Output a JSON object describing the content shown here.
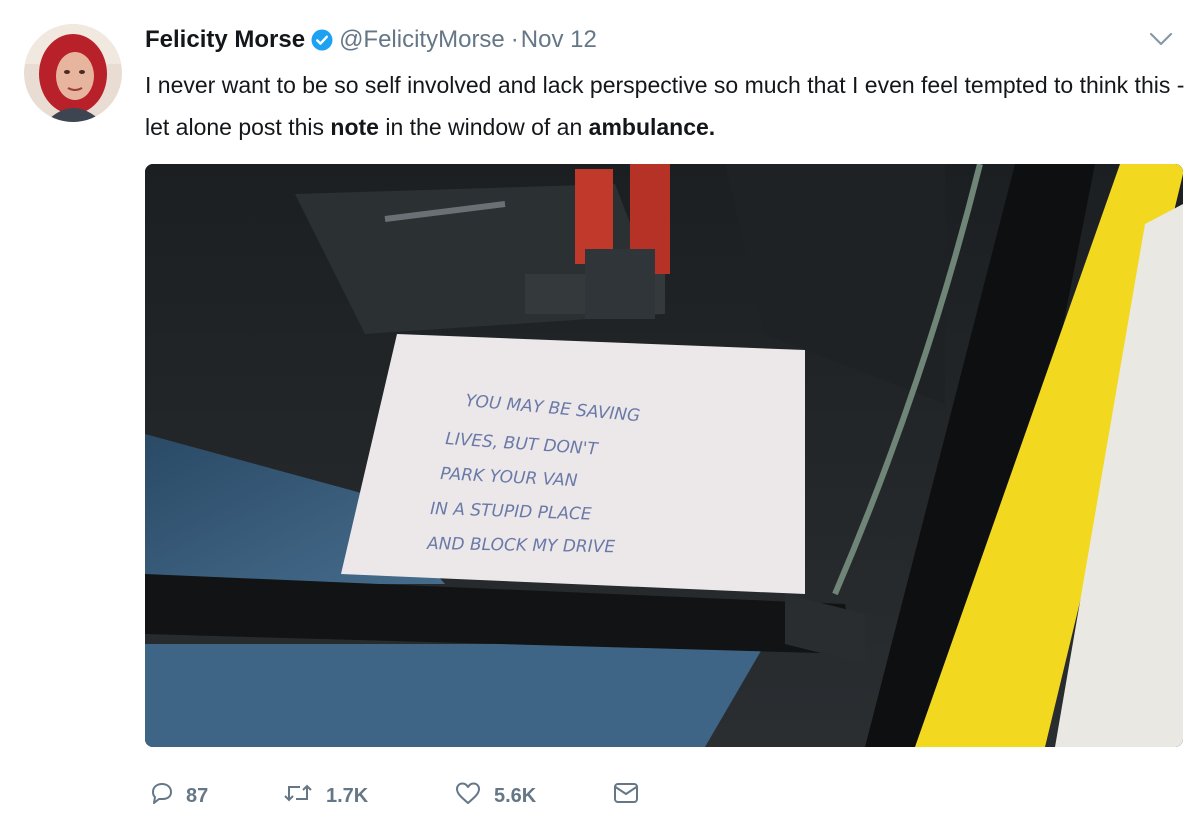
{
  "tweet": {
    "author_name": "Felicity Morse",
    "handle": "@FelicityMorse",
    "separator": "·",
    "date": "Nov 12",
    "text_part1": "I never want to be so self involved and lack perspective so much that I even feel tempted to think this - let alone post this ",
    "text_bold1": "note",
    "text_part2": " in the window of an ",
    "text_bold2": "ambulance.",
    "note_lines": [
      "YOU MAY BE SAVING",
      "LIVES, BUT DON'T",
      "PARK YOUR VAN",
      "IN A STUPID PLACE",
      "AND BLOCK MY DRIVE"
    ]
  },
  "actions": {
    "replies": "87",
    "retweets": "1.7K",
    "likes": "5.6K"
  },
  "icons": {
    "verified": "verified-badge-icon",
    "more": "chevron-down-icon",
    "reply": "reply-icon",
    "retweet": "retweet-icon",
    "like": "heart-icon",
    "message": "envelope-icon"
  },
  "colors": {
    "verified_blue": "#1da1f2",
    "secondary_text": "#657786",
    "primary_text": "#14171a",
    "ambulance_yellow": "#f2d81f"
  }
}
